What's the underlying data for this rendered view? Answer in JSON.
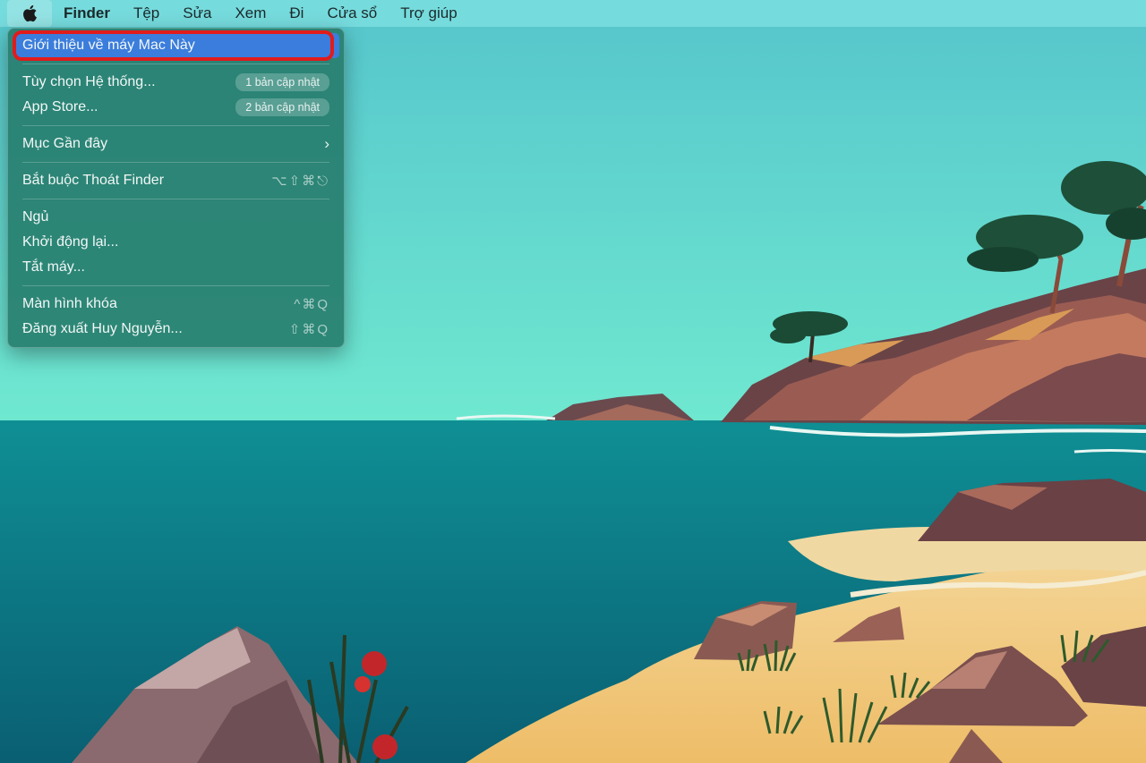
{
  "menubar": {
    "apple_icon": "apple-logo-icon",
    "items": [
      "Finder",
      "Tệp",
      "Sửa",
      "Xem",
      "Đi",
      "Cửa sổ",
      "Trợ giúp"
    ]
  },
  "apple_menu": {
    "about": "Giới thiệu về máy Mac Này",
    "system_prefs": "Tùy chọn Hệ thống...",
    "system_prefs_badge": "1 bản cập nhật",
    "app_store": "App Store...",
    "app_store_badge": "2 bản cập nhật",
    "recent_items": "Mục Gần đây",
    "force_quit": "Bắt buộc Thoát Finder",
    "force_quit_shortcut": "⌥⇧⌘⎋",
    "sleep": "Ngủ",
    "restart": "Khởi động lại...",
    "shutdown": "Tắt máy...",
    "lock_screen": "Màn hình khóa",
    "lock_screen_shortcut": "^⌘Q",
    "logout": "Đăng xuất Huy Nguyễn...",
    "logout_shortcut": "⇧⌘Q"
  },
  "colors": {
    "highlight": "#3b7ddc",
    "annotation_ring": "#e21b1b",
    "menu_bg": "#247a6a"
  }
}
